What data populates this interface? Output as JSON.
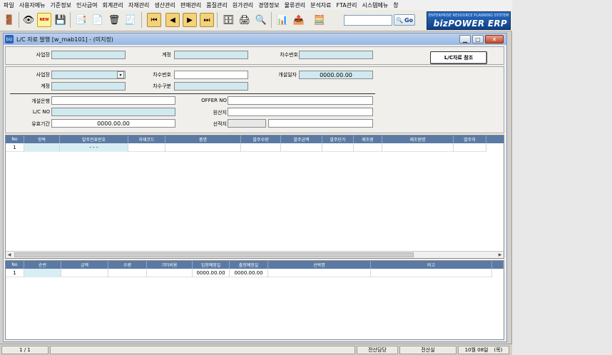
{
  "menu": [
    "파일",
    "사용자메뉴",
    "기준정보",
    "인사급여",
    "회계관리",
    "자재관리",
    "생산관리",
    "판매관리",
    "품질관리",
    "원가관리",
    "경영정보",
    "물류관리",
    "분석자료",
    "FTA관리",
    "시스템메뉴",
    "창"
  ],
  "toolbar": {
    "go_label": "Go",
    "search_value": "",
    "brand_sub": "ENTERPRISE RESOURCE PLANNING SYSTEM",
    "brand_main": "bizPOWER ERP",
    "new_badge": "NEW"
  },
  "window": {
    "title": "L/C 자료 발행 [w_mab101] - (미지정)",
    "icon_text": "biz"
  },
  "top_panel": {
    "site_label": "사업장",
    "site_value": "",
    "account_label": "계정",
    "account_value": "",
    "seq_label": "차수번호",
    "seq_value": "",
    "lc_ref_button": "L/C자료 참조"
  },
  "detail": {
    "site_label": "사업장",
    "site_value": "",
    "seq_no_label": "차수번호",
    "seq_no_value": "",
    "open_date_label": "개설일자",
    "open_date_value": "0000.00.00",
    "account_label": "계정",
    "account_value": "",
    "seq_type_label": "차수구분",
    "seq_type_value": "",
    "bank_label": "개설은행",
    "bank_value": "",
    "offer_label": "OFFER NO",
    "offer_value": "",
    "lcno_label": "L/C NO",
    "lcno_value": "",
    "origin_label": "원산지",
    "origin_value": "",
    "validity_label": "유효기간",
    "validity_value": "0000.00.00",
    "shipping_label": "선적지",
    "shipping_value_a": "",
    "shipping_value_b": ""
  },
  "grid1": {
    "columns": [
      "No",
      "항목",
      "발주전표번호",
      "자재코드",
      "품명",
      "발주수량",
      "발주금액",
      "발주단가",
      "제조원",
      "제조원명",
      "발주처"
    ],
    "rows": [
      [
        "1",
        "",
        "-   -   -",
        "",
        "",
        "",
        "",
        "",
        "",
        "",
        ""
      ]
    ]
  },
  "grid2": {
    "columns": [
      "No",
      "순번",
      "금액",
      "수량",
      "기타비용",
      "입항예정일",
      "출항예정일",
      "선박명",
      "비고"
    ],
    "rows": [
      [
        "1",
        "",
        "",
        "",
        "",
        "0000.00.00",
        "0000.00.00",
        "",
        ""
      ]
    ]
  },
  "status": {
    "page": "1 / 1",
    "dept": "전산담당",
    "office": "전산실",
    "date": "10월 08일",
    "weekday": "(목)"
  }
}
